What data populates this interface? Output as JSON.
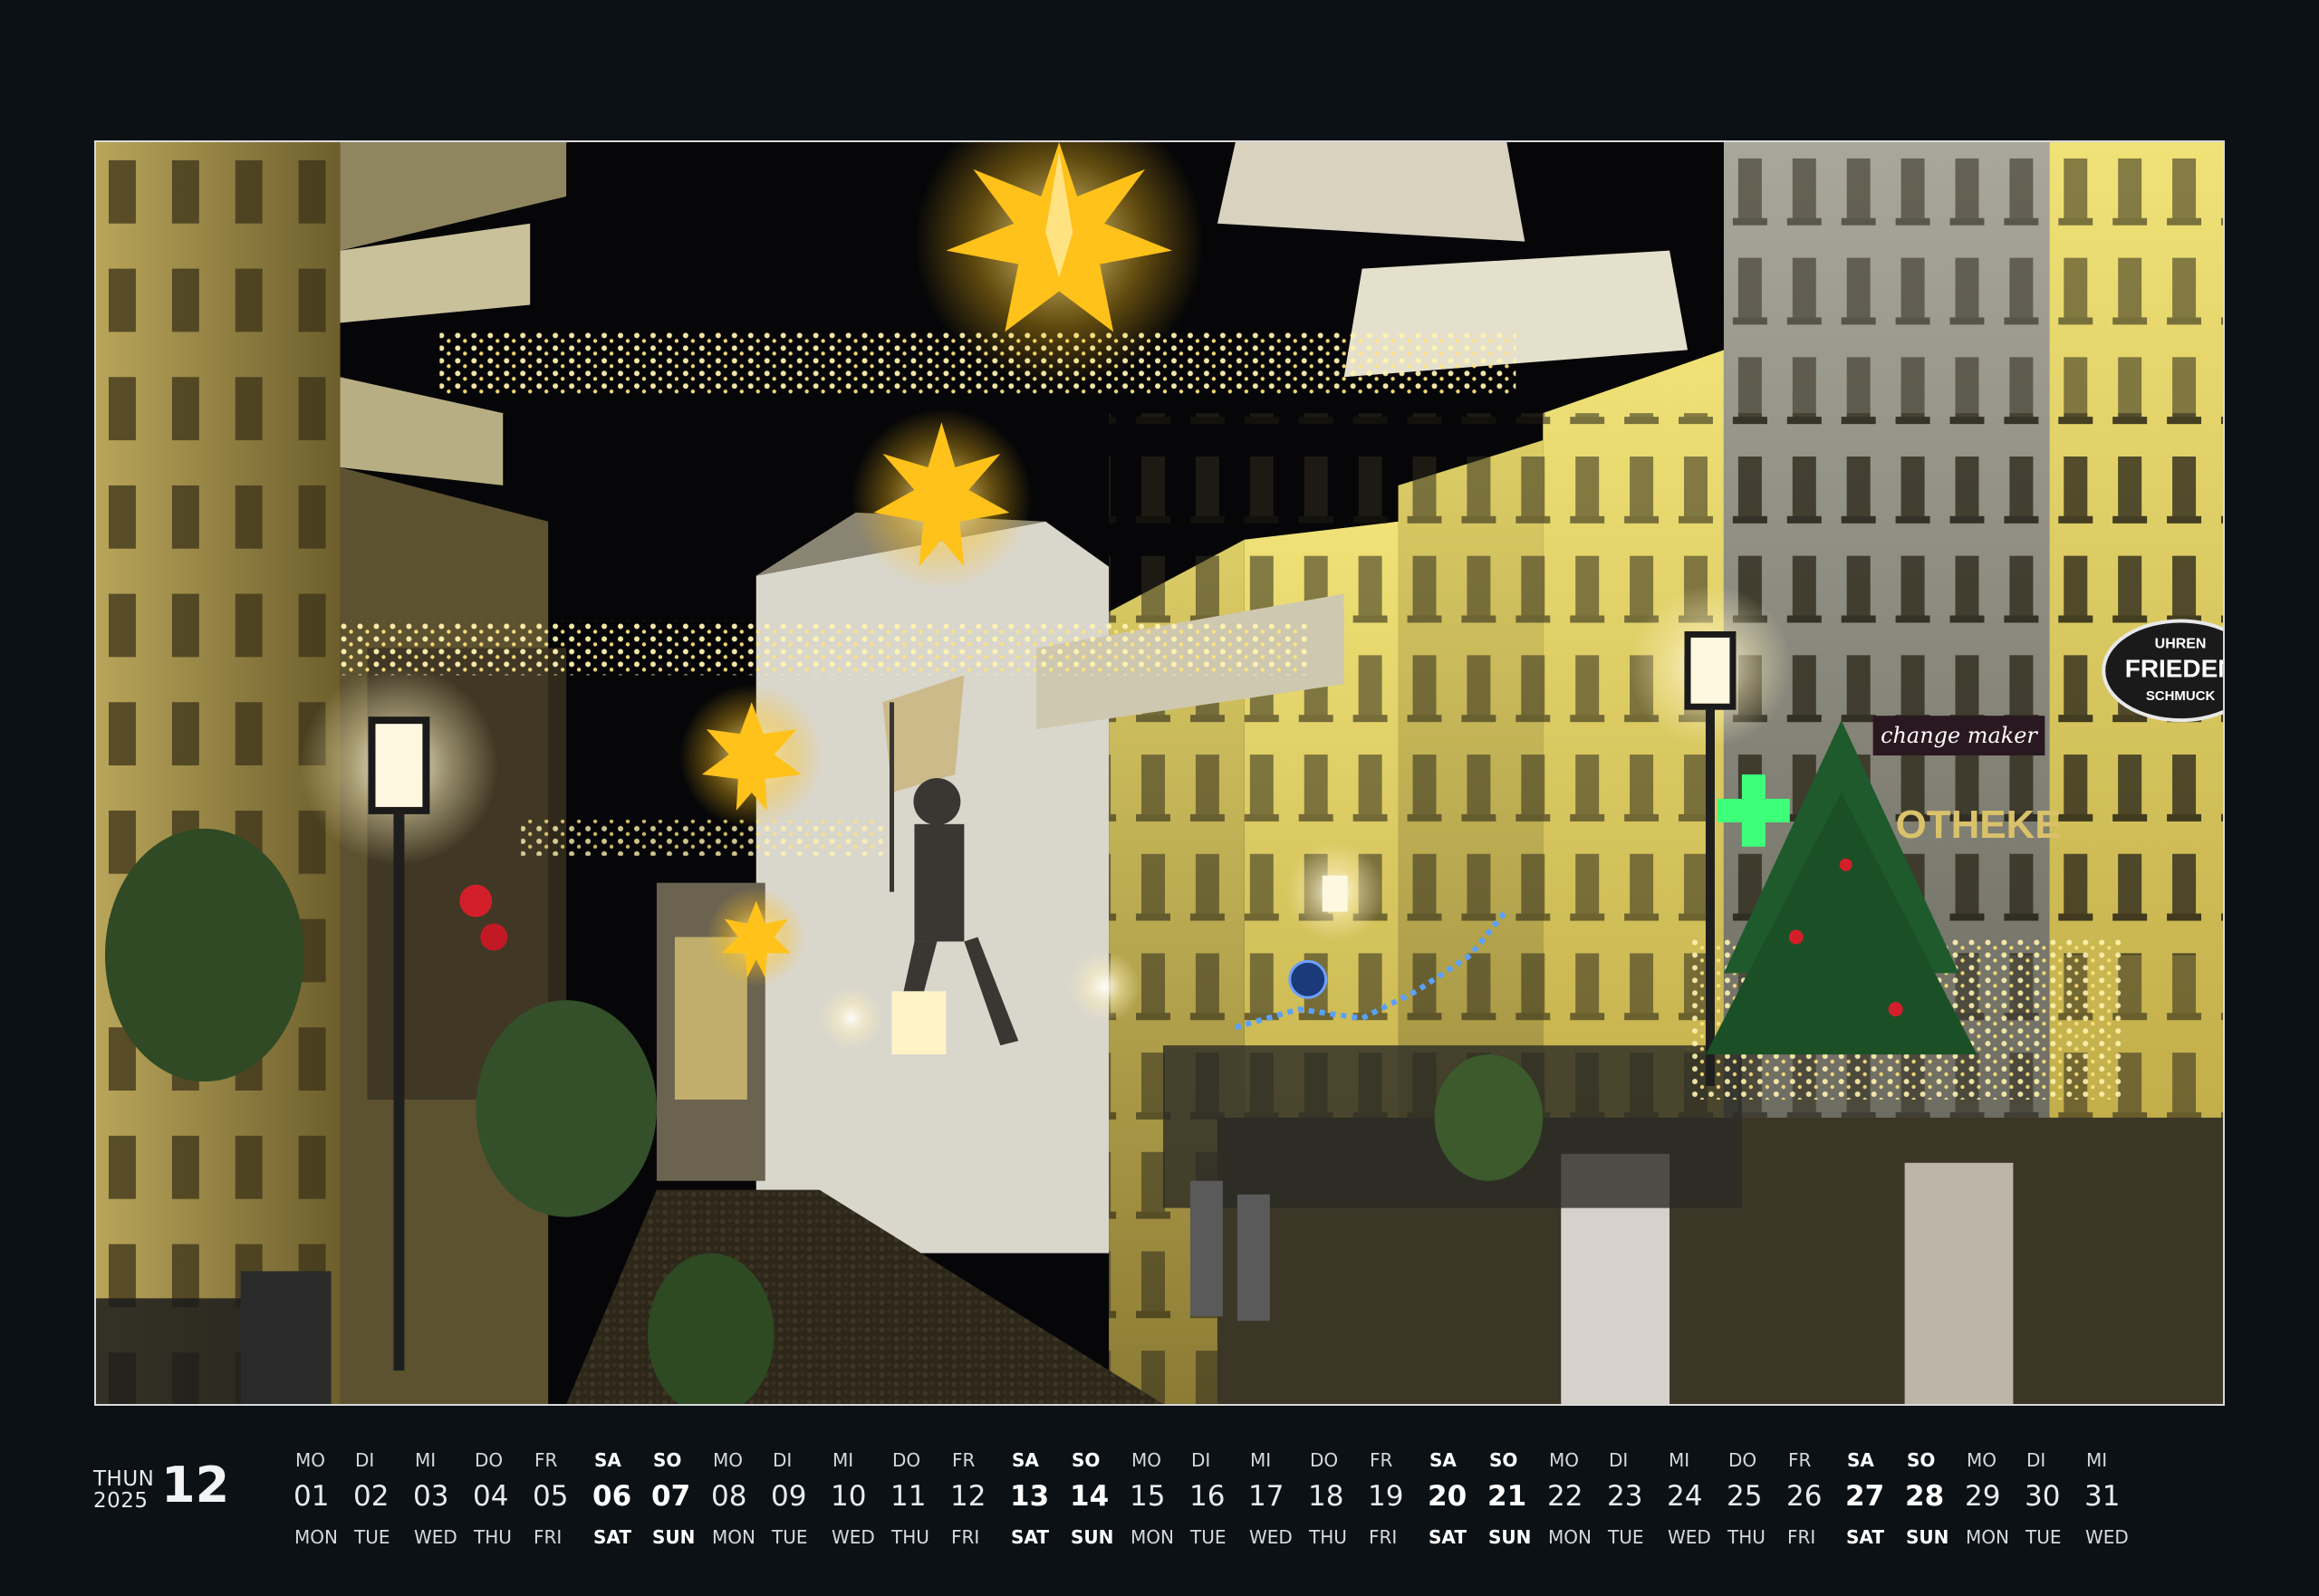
{
  "calendar": {
    "place": "THUN",
    "year": "2025",
    "month_number": "12",
    "days": [
      {
        "de": "MO",
        "num": "01",
        "en": "MON",
        "weekend": false
      },
      {
        "de": "DI",
        "num": "02",
        "en": "TUE",
        "weekend": false
      },
      {
        "de": "MI",
        "num": "03",
        "en": "WED",
        "weekend": false
      },
      {
        "de": "DO",
        "num": "04",
        "en": "THU",
        "weekend": false
      },
      {
        "de": "FR",
        "num": "05",
        "en": "FRI",
        "weekend": false
      },
      {
        "de": "SA",
        "num": "06",
        "en": "SAT",
        "weekend": true
      },
      {
        "de": "SO",
        "num": "07",
        "en": "SUN",
        "weekend": true
      },
      {
        "de": "MO",
        "num": "08",
        "en": "MON",
        "weekend": false
      },
      {
        "de": "DI",
        "num": "09",
        "en": "TUE",
        "weekend": false
      },
      {
        "de": "MI",
        "num": "10",
        "en": "WED",
        "weekend": false
      },
      {
        "de": "DO",
        "num": "11",
        "en": "THU",
        "weekend": false
      },
      {
        "de": "FR",
        "num": "12",
        "en": "FRI",
        "weekend": false
      },
      {
        "de": "SA",
        "num": "13",
        "en": "SAT",
        "weekend": true
      },
      {
        "de": "SO",
        "num": "14",
        "en": "SUN",
        "weekend": true
      },
      {
        "de": "MO",
        "num": "15",
        "en": "MON",
        "weekend": false
      },
      {
        "de": "DI",
        "num": "16",
        "en": "TUE",
        "weekend": false
      },
      {
        "de": "MI",
        "num": "17",
        "en": "WED",
        "weekend": false
      },
      {
        "de": "DO",
        "num": "18",
        "en": "THU",
        "weekend": false
      },
      {
        "de": "FR",
        "num": "19",
        "en": "FRI",
        "weekend": false
      },
      {
        "de": "SA",
        "num": "20",
        "en": "SAT",
        "weekend": true
      },
      {
        "de": "SO",
        "num": "21",
        "en": "SUN",
        "weekend": true
      },
      {
        "de": "MO",
        "num": "22",
        "en": "MON",
        "weekend": false
      },
      {
        "de": "DI",
        "num": "23",
        "en": "TUE",
        "weekend": false
      },
      {
        "de": "MI",
        "num": "24",
        "en": "WED",
        "weekend": false
      },
      {
        "de": "DO",
        "num": "25",
        "en": "THU",
        "weekend": false
      },
      {
        "de": "FR",
        "num": "26",
        "en": "FRI",
        "weekend": false
      },
      {
        "de": "SA",
        "num": "27",
        "en": "SAT",
        "weekend": true
      },
      {
        "de": "SO",
        "num": "28",
        "en": "SUN",
        "weekend": true
      },
      {
        "de": "MO",
        "num": "29",
        "en": "MON",
        "weekend": false
      },
      {
        "de": "DI",
        "num": "30",
        "en": "TUE",
        "weekend": false
      },
      {
        "de": "MI",
        "num": "31",
        "en": "WED",
        "weekend": false
      }
    ]
  },
  "photo": {
    "signs": {
      "uhren": "UHREN",
      "frieden": "FRIEDEN",
      "schmuck": "SCHMUCK",
      "change_maker": "change maker",
      "apotheke": "OTHEKE"
    }
  },
  "colors": {
    "background": "#0c1116",
    "text": "#e8eaec",
    "star": "#ffc21a",
    "lights": "#ffe37a",
    "pharmacy_cross": "#3dff7a",
    "photo_border": "#d9d9d9"
  }
}
